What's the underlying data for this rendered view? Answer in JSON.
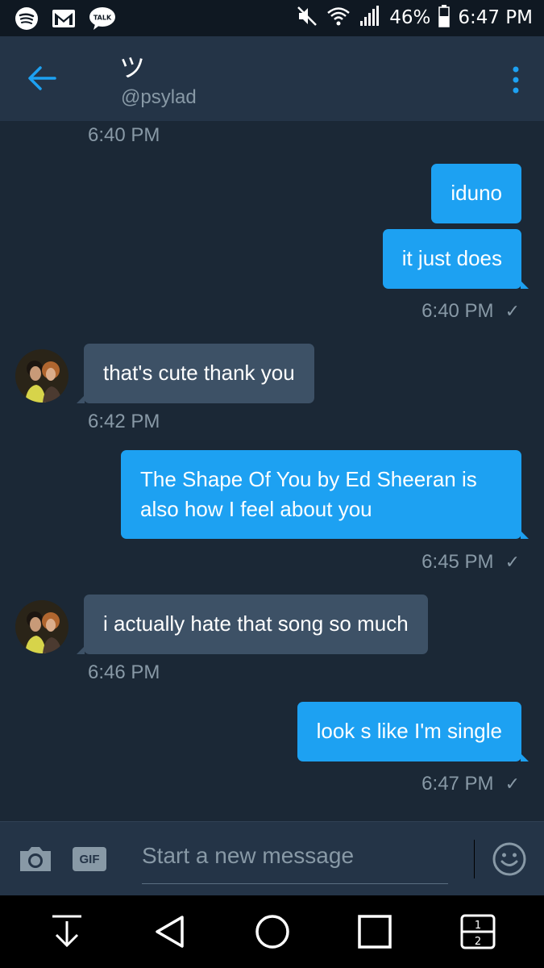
{
  "status_bar": {
    "left_icons": [
      "spotify-icon",
      "gmail-icon",
      "talk-icon"
    ],
    "talk_label": "TALK",
    "battery": "46%",
    "time": "6:47 PM"
  },
  "header": {
    "name": "ツ",
    "handle": "@psylad"
  },
  "messages": [
    {
      "type": "time",
      "text": "6:40 PM"
    },
    {
      "type": "out",
      "text": "iduno"
    },
    {
      "type": "out",
      "text": "it just does"
    },
    {
      "type": "time_out",
      "text": "6:40 PM",
      "check": "✓"
    },
    {
      "type": "in",
      "text": "that's cute thank you"
    },
    {
      "type": "time",
      "text": "6:42 PM"
    },
    {
      "type": "out",
      "text": "The Shape Of You by Ed Sheeran is also how I feel about you"
    },
    {
      "type": "time_out",
      "text": "6:45 PM",
      "check": "✓"
    },
    {
      "type": "in",
      "text": "i actually hate that song so much"
    },
    {
      "type": "time",
      "text": "6:46 PM"
    },
    {
      "type": "out",
      "text": "look s like I'm single"
    },
    {
      "type": "time_out",
      "text": "6:47 PM",
      "check": "✓"
    }
  ],
  "composer": {
    "gif_label": "GIF",
    "placeholder": "Start a new message"
  },
  "colors": {
    "background": "#1b2836",
    "header": "#243447",
    "outgoing_bubble": "#1da1f2",
    "incoming_bubble": "#3d5166",
    "muted_text": "#8899a6"
  }
}
